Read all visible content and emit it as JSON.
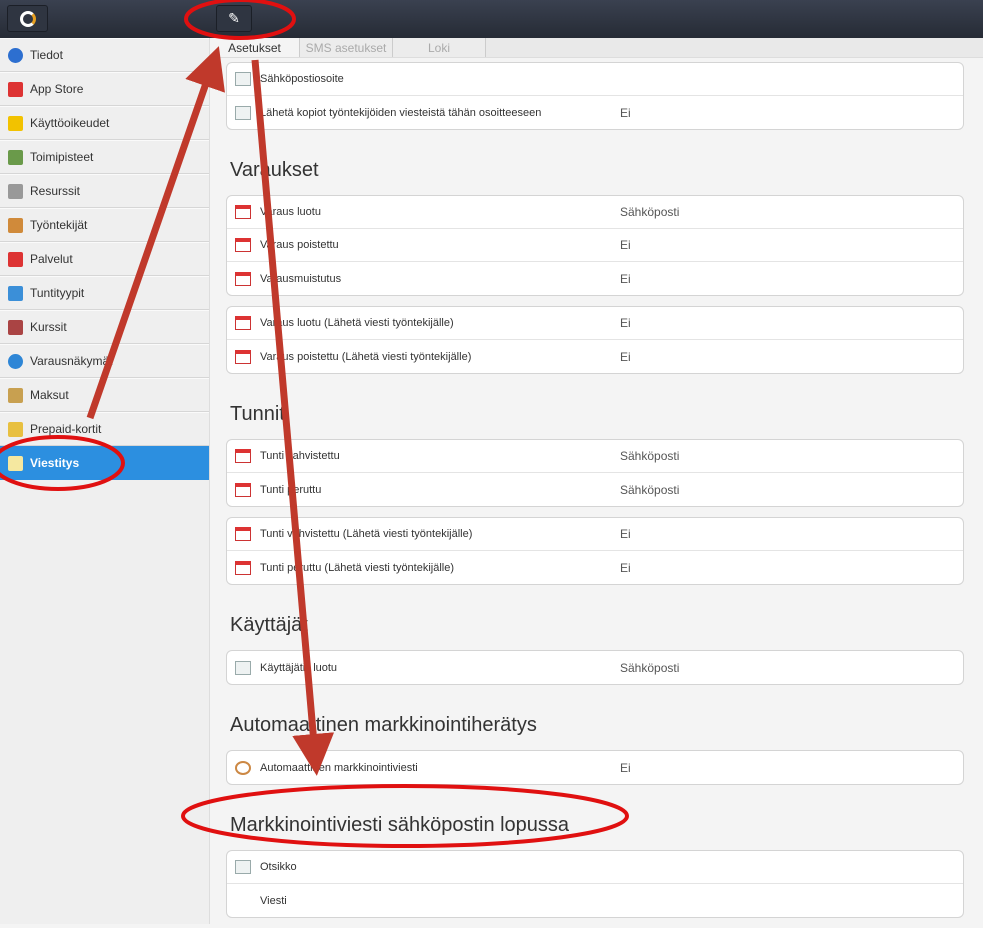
{
  "topbar": {
    "logo_icon": "app-logo-icon",
    "edit_icon": "pencil-icon"
  },
  "sidebar": {
    "items": [
      {
        "label": "Tiedot",
        "icon": "info-icon",
        "color": "#2d6fd0"
      },
      {
        "label": "App Store",
        "icon": "store-icon",
        "color": "#d33"
      },
      {
        "label": "Käyttöoikeudet",
        "icon": "star-icon",
        "color": "#f2c200"
      },
      {
        "label": "Toimipisteet",
        "icon": "picture-icon",
        "color": "#6a9a4a"
      },
      {
        "label": "Resurssit",
        "icon": "house-icon",
        "color": "#999"
      },
      {
        "label": "Työntekijät",
        "icon": "users-icon",
        "color": "#d08a3a"
      },
      {
        "label": "Palvelut",
        "icon": "calendar-icon",
        "color": "#d33"
      },
      {
        "label": "Tuntityypit",
        "icon": "calendar-blue-icon",
        "color": "#3b8fd8"
      },
      {
        "label": "Kurssit",
        "icon": "book-icon",
        "color": "#aa4444"
      },
      {
        "label": "Varausnäkymät",
        "icon": "globe-icon",
        "color": "#2e86d6"
      },
      {
        "label": "Maksut",
        "icon": "money-icon",
        "color": "#c8a050"
      },
      {
        "label": "Prepaid-kortit",
        "icon": "card-icon",
        "color": "#e8c040"
      },
      {
        "label": "Viestitys",
        "icon": "chat-icon",
        "color": "#f5e8a0",
        "active": true
      }
    ]
  },
  "tabs": [
    "Asetukset",
    "SMS asetukset",
    "Loki"
  ],
  "top_card": [
    {
      "label": "Sähköpostiosoite",
      "value": ""
    },
    {
      "label": "Lähetä kopiot työntekijöiden viesteistä tähän osoitteeseen",
      "value": "Ei"
    }
  ],
  "sections": {
    "varaukset": {
      "title": "Varaukset",
      "cards": [
        [
          {
            "label": "Varaus luotu",
            "value": "Sähköposti",
            "icon": "calendar-add-icon"
          },
          {
            "label": "Varaus poistettu",
            "value": "Ei",
            "icon": "calendar-remove-icon"
          },
          {
            "label": "Varausmuistutus",
            "value": "Ei",
            "icon": "calendar-31-icon"
          }
        ],
        [
          {
            "label": "Varaus luotu (Lähetä viesti työntekijälle)",
            "value": "Ei",
            "icon": "calendar-add-icon"
          },
          {
            "label": "Varaus poistettu (Lähetä viesti työntekijälle)",
            "value": "Ei",
            "icon": "calendar-remove-icon"
          }
        ]
      ]
    },
    "tunnit": {
      "title": "Tunnit",
      "cards": [
        [
          {
            "label": "Tunti vahvistettu",
            "value": "Sähköposti"
          },
          {
            "label": "Tunti peruttu",
            "value": "Sähköposti"
          }
        ],
        [
          {
            "label": "Tunti vahvistettu (Lähetä viesti työntekijälle)",
            "value": "Ei"
          },
          {
            "label": "Tunti peruttu (Lähetä viesti työntekijälle)",
            "value": "Ei"
          }
        ]
      ]
    },
    "kayttajat": {
      "title": "Käyttäjät",
      "rows": [
        {
          "label": "Käyttäjätili luotu",
          "value": "Sähköposti"
        }
      ]
    },
    "automaattinen": {
      "title": "Automaattinen markkinointiherätys",
      "rows": [
        {
          "label": "Automaattinen markkinointiviesti",
          "value": "Ei"
        }
      ]
    },
    "markkinointi": {
      "title": "Markkinointiviesti sähköpostin lopussa",
      "rows": [
        {
          "label": "Otsikko"
        },
        {
          "label": "Viesti"
        }
      ]
    }
  },
  "annotation_color": "#c0392b"
}
